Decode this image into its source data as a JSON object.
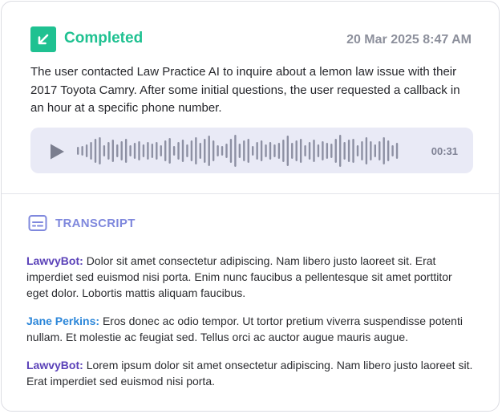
{
  "status": {
    "label": "Completed",
    "icon": "arrow-down-left-icon",
    "color": "#1fc191"
  },
  "timestamp": "20 Mar 2025 8:47 AM",
  "summary": "The user contacted Law Practice AI to inquire about a lemon law issue with their 2017 Toyota Camry. After some initial questions, the user requested a callback in an hour at a specific phone number.",
  "player": {
    "duration": "00:31",
    "icon": "play-icon",
    "waveform_icon": "waveform-icon"
  },
  "transcript": {
    "title": "TRANSCRIPT",
    "icon": "subtitles-icon",
    "messages": [
      {
        "speaker": "LawvyBot:",
        "speaker_color": "#5a41b8",
        "text": "Dolor sit amet consectetur adipiscing. Nam libero justo laoreet sit. Erat imperdiet sed euismod nisi porta. Enim nunc faucibus a pellentesque sit amet porttitor eget dolor. Lobortis mattis aliquam faucibus."
      },
      {
        "speaker": "Jane Perkins:",
        "speaker_color": "#2b86d9",
        "text": "Eros donec ac odio tempor. Ut tortor pretium viverra suspendisse potenti nullam. Et molestie ac feugiat sed. Tellus orci ac auctor augue mauris augue."
      },
      {
        "speaker": "LawvyBot:",
        "speaker_color": "#5a41b8",
        "text": "Lorem ipsum dolor sit amet onsectetur adipiscing. Nam libero justo laoreet sit. Erat imperdiet sed euismod nisi porta."
      }
    ]
  }
}
